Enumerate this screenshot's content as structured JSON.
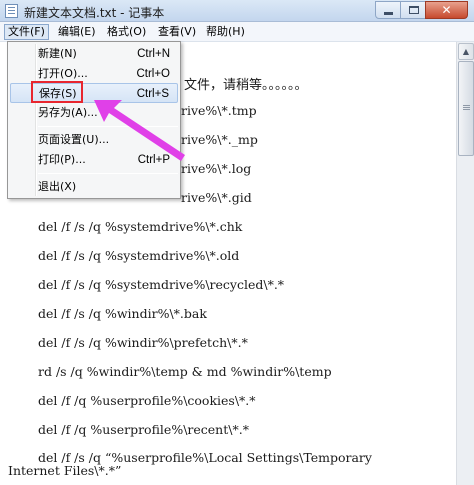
{
  "window": {
    "title": "新建文本文档.txt - 记事本",
    "close_glyph": "✕"
  },
  "menubar": {
    "file": "文件(F)",
    "edit": "编辑(E)",
    "format": "格式(O)",
    "view": "查看(V)",
    "help": "帮助(H)"
  },
  "file_menu": {
    "items": [
      {
        "label": "新建(N)",
        "shortcut": "Ctrl+N"
      },
      {
        "label": "打开(O)...",
        "shortcut": "Ctrl+O"
      },
      {
        "label": "保存(S)",
        "shortcut": "Ctrl+S"
      },
      {
        "label": "另存为(A)...",
        "shortcut": ""
      },
      {
        "label": "页面设置(U)...",
        "shortcut": ""
      },
      {
        "label": "打印(P)...",
        "shortcut": "Ctrl+P"
      },
      {
        "label": "退出(X)",
        "shortcut": ""
      }
    ]
  },
  "editor": {
    "lines": [
      "文件，请稍等。。。。。。",
      "rive%\\*.tmp",
      "rive%\\*._mp",
      "rive%\\*.log",
      "rive%\\*.gid",
      "del /f /s /q %systemdrive%\\*.chk",
      "del /f /s /q %systemdrive%\\*.old",
      "del /f /s /q %systemdrive%\\recycled\\*.*",
      "del /f /s /q %windir%\\*.bak",
      "del /f /s /q %windir%\\prefetch\\*.*",
      "rd /s /q %windir%\\temp & md %windir%\\temp",
      "del /f /q %userprofile%\\cookies\\*.*",
      "del /f /q %userprofile%\\recent\\*.*",
      "del /f /s /q “%userprofile%\\Local Settings\\Temporary",
      "Internet Files\\*.*”"
    ]
  },
  "colors": {
    "highlight_box": "#e8262f",
    "arrow": "#e040e8"
  }
}
